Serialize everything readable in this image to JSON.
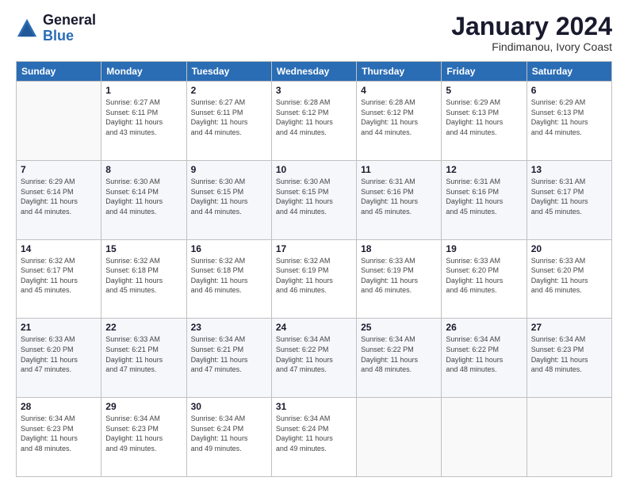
{
  "logo": {
    "general": "General",
    "blue": "Blue"
  },
  "title": "January 2024",
  "location": "Findimanou, Ivory Coast",
  "days_of_week": [
    "Sunday",
    "Monday",
    "Tuesday",
    "Wednesday",
    "Thursday",
    "Friday",
    "Saturday"
  ],
  "weeks": [
    [
      {
        "day": "",
        "info": ""
      },
      {
        "day": "1",
        "info": "Sunrise: 6:27 AM\nSunset: 6:11 PM\nDaylight: 11 hours\nand 43 minutes."
      },
      {
        "day": "2",
        "info": "Sunrise: 6:27 AM\nSunset: 6:11 PM\nDaylight: 11 hours\nand 44 minutes."
      },
      {
        "day": "3",
        "info": "Sunrise: 6:28 AM\nSunset: 6:12 PM\nDaylight: 11 hours\nand 44 minutes."
      },
      {
        "day": "4",
        "info": "Sunrise: 6:28 AM\nSunset: 6:12 PM\nDaylight: 11 hours\nand 44 minutes."
      },
      {
        "day": "5",
        "info": "Sunrise: 6:29 AM\nSunset: 6:13 PM\nDaylight: 11 hours\nand 44 minutes."
      },
      {
        "day": "6",
        "info": "Sunrise: 6:29 AM\nSunset: 6:13 PM\nDaylight: 11 hours\nand 44 minutes."
      }
    ],
    [
      {
        "day": "7",
        "info": "Sunrise: 6:29 AM\nSunset: 6:14 PM\nDaylight: 11 hours\nand 44 minutes."
      },
      {
        "day": "8",
        "info": "Sunrise: 6:30 AM\nSunset: 6:14 PM\nDaylight: 11 hours\nand 44 minutes."
      },
      {
        "day": "9",
        "info": "Sunrise: 6:30 AM\nSunset: 6:15 PM\nDaylight: 11 hours\nand 44 minutes."
      },
      {
        "day": "10",
        "info": "Sunrise: 6:30 AM\nSunset: 6:15 PM\nDaylight: 11 hours\nand 44 minutes."
      },
      {
        "day": "11",
        "info": "Sunrise: 6:31 AM\nSunset: 6:16 PM\nDaylight: 11 hours\nand 45 minutes."
      },
      {
        "day": "12",
        "info": "Sunrise: 6:31 AM\nSunset: 6:16 PM\nDaylight: 11 hours\nand 45 minutes."
      },
      {
        "day": "13",
        "info": "Sunrise: 6:31 AM\nSunset: 6:17 PM\nDaylight: 11 hours\nand 45 minutes."
      }
    ],
    [
      {
        "day": "14",
        "info": "Sunrise: 6:32 AM\nSunset: 6:17 PM\nDaylight: 11 hours\nand 45 minutes."
      },
      {
        "day": "15",
        "info": "Sunrise: 6:32 AM\nSunset: 6:18 PM\nDaylight: 11 hours\nand 45 minutes."
      },
      {
        "day": "16",
        "info": "Sunrise: 6:32 AM\nSunset: 6:18 PM\nDaylight: 11 hours\nand 46 minutes."
      },
      {
        "day": "17",
        "info": "Sunrise: 6:32 AM\nSunset: 6:19 PM\nDaylight: 11 hours\nand 46 minutes."
      },
      {
        "day": "18",
        "info": "Sunrise: 6:33 AM\nSunset: 6:19 PM\nDaylight: 11 hours\nand 46 minutes."
      },
      {
        "day": "19",
        "info": "Sunrise: 6:33 AM\nSunset: 6:20 PM\nDaylight: 11 hours\nand 46 minutes."
      },
      {
        "day": "20",
        "info": "Sunrise: 6:33 AM\nSunset: 6:20 PM\nDaylight: 11 hours\nand 46 minutes."
      }
    ],
    [
      {
        "day": "21",
        "info": "Sunrise: 6:33 AM\nSunset: 6:20 PM\nDaylight: 11 hours\nand 47 minutes."
      },
      {
        "day": "22",
        "info": "Sunrise: 6:33 AM\nSunset: 6:21 PM\nDaylight: 11 hours\nand 47 minutes."
      },
      {
        "day": "23",
        "info": "Sunrise: 6:34 AM\nSunset: 6:21 PM\nDaylight: 11 hours\nand 47 minutes."
      },
      {
        "day": "24",
        "info": "Sunrise: 6:34 AM\nSunset: 6:22 PM\nDaylight: 11 hours\nand 47 minutes."
      },
      {
        "day": "25",
        "info": "Sunrise: 6:34 AM\nSunset: 6:22 PM\nDaylight: 11 hours\nand 48 minutes."
      },
      {
        "day": "26",
        "info": "Sunrise: 6:34 AM\nSunset: 6:22 PM\nDaylight: 11 hours\nand 48 minutes."
      },
      {
        "day": "27",
        "info": "Sunrise: 6:34 AM\nSunset: 6:23 PM\nDaylight: 11 hours\nand 48 minutes."
      }
    ],
    [
      {
        "day": "28",
        "info": "Sunrise: 6:34 AM\nSunset: 6:23 PM\nDaylight: 11 hours\nand 48 minutes."
      },
      {
        "day": "29",
        "info": "Sunrise: 6:34 AM\nSunset: 6:23 PM\nDaylight: 11 hours\nand 49 minutes."
      },
      {
        "day": "30",
        "info": "Sunrise: 6:34 AM\nSunset: 6:24 PM\nDaylight: 11 hours\nand 49 minutes."
      },
      {
        "day": "31",
        "info": "Sunrise: 6:34 AM\nSunset: 6:24 PM\nDaylight: 11 hours\nand 49 minutes."
      },
      {
        "day": "",
        "info": ""
      },
      {
        "day": "",
        "info": ""
      },
      {
        "day": "",
        "info": ""
      }
    ]
  ]
}
